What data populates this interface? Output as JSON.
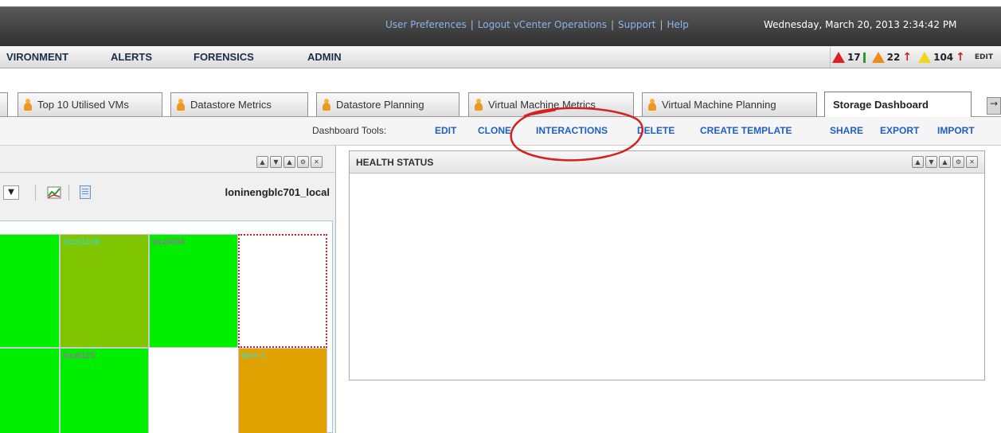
{
  "top": {
    "links": [
      "User Preferences",
      "Logout vCenter Operations",
      "Support",
      "Help"
    ],
    "separator": "|",
    "datetime": "Wednesday, March 20, 2013 2:34:42 PM"
  },
  "nav": {
    "items": [
      "VIRONMENT",
      "ALERTS",
      "FORENSICS",
      "ADMIN"
    ],
    "alerts": [
      {
        "level": "critical",
        "count": "17",
        "trend": "flat"
      },
      {
        "level": "warning",
        "count": "22",
        "trend": "up"
      },
      {
        "level": "minor",
        "count": "104",
        "trend": "up"
      }
    ],
    "edit_label": "EDIT"
  },
  "tabs": [
    {
      "label": "Top 10 Utilised VMs",
      "active": false
    },
    {
      "label": "Datastore Metrics",
      "active": false
    },
    {
      "label": "Datastore Planning",
      "active": false
    },
    {
      "label": "Virtual Machine Metrics",
      "active": false
    },
    {
      "label": "Virtual Machine Planning",
      "active": false
    },
    {
      "label": "Storage Dashboard",
      "active": true
    }
  ],
  "tools": {
    "label": "Dashboard Tools:",
    "links": [
      "EDIT",
      "CLONE",
      "INTERACTIONS",
      "DELETE",
      "CREATE TEMPLATE",
      "SHARE",
      "EXPORT",
      "IMPORT"
    ]
  },
  "left_panel": {
    "resource": "loninengblc701_local",
    "cells": [
      {
        "label": "",
        "color": "#00ee00",
        "label_color": "#38d8d8"
      },
      {
        "label": "local1108",
        "color": "#7fc600",
        "label_color": "#38d8d8"
      },
      {
        "label": "local404",
        "color": "#00ee00",
        "label_color": "#c050c0"
      },
      {
        "label": "",
        "color": "#ffffff",
        "label_color": "#38d8d8"
      },
      {
        "label": "",
        "color": "#00ee00",
        "label_color": "#38d8d8"
      },
      {
        "label": "local115",
        "color": "#00ee00",
        "label_color": "#c050c0"
      },
      {
        "label": "",
        "color": "#ffffff",
        "label_color": "#38d8d8"
      },
      {
        "label": "tierx-1",
        "color": "#e0a200",
        "label_color": "#38d8d8"
      }
    ]
  },
  "right_panel": {
    "title": "HEALTH STATUS"
  },
  "colors": {
    "annotation": "#d42020",
    "link": "#1f5fc4"
  }
}
